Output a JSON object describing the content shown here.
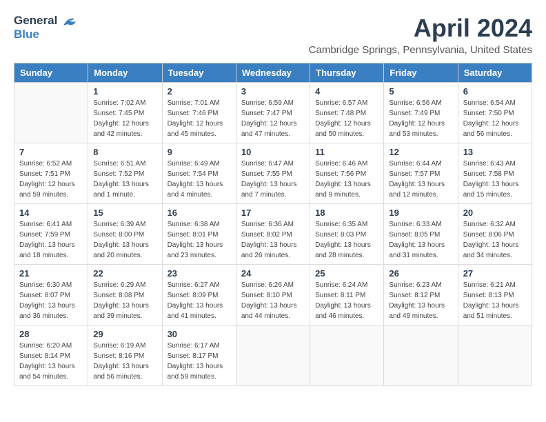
{
  "logo": {
    "general": "General",
    "blue": "Blue"
  },
  "title": "April 2024",
  "subtitle": "Cambridge Springs, Pennsylvania, United States",
  "days_of_week": [
    "Sunday",
    "Monday",
    "Tuesday",
    "Wednesday",
    "Thursday",
    "Friday",
    "Saturday"
  ],
  "weeks": [
    [
      {
        "day": "",
        "info": ""
      },
      {
        "day": "1",
        "info": "Sunrise: 7:02 AM\nSunset: 7:45 PM\nDaylight: 12 hours\nand 42 minutes."
      },
      {
        "day": "2",
        "info": "Sunrise: 7:01 AM\nSunset: 7:46 PM\nDaylight: 12 hours\nand 45 minutes."
      },
      {
        "day": "3",
        "info": "Sunrise: 6:59 AM\nSunset: 7:47 PM\nDaylight: 12 hours\nand 47 minutes."
      },
      {
        "day": "4",
        "info": "Sunrise: 6:57 AM\nSunset: 7:48 PM\nDaylight: 12 hours\nand 50 minutes."
      },
      {
        "day": "5",
        "info": "Sunrise: 6:56 AM\nSunset: 7:49 PM\nDaylight: 12 hours\nand 53 minutes."
      },
      {
        "day": "6",
        "info": "Sunrise: 6:54 AM\nSunset: 7:50 PM\nDaylight: 12 hours\nand 56 minutes."
      }
    ],
    [
      {
        "day": "7",
        "info": "Sunrise: 6:52 AM\nSunset: 7:51 PM\nDaylight: 12 hours\nand 59 minutes."
      },
      {
        "day": "8",
        "info": "Sunrise: 6:51 AM\nSunset: 7:52 PM\nDaylight: 13 hours\nand 1 minute."
      },
      {
        "day": "9",
        "info": "Sunrise: 6:49 AM\nSunset: 7:54 PM\nDaylight: 13 hours\nand 4 minutes."
      },
      {
        "day": "10",
        "info": "Sunrise: 6:47 AM\nSunset: 7:55 PM\nDaylight: 13 hours\nand 7 minutes."
      },
      {
        "day": "11",
        "info": "Sunrise: 6:46 AM\nSunset: 7:56 PM\nDaylight: 13 hours\nand 9 minutes."
      },
      {
        "day": "12",
        "info": "Sunrise: 6:44 AM\nSunset: 7:57 PM\nDaylight: 13 hours\nand 12 minutes."
      },
      {
        "day": "13",
        "info": "Sunrise: 6:43 AM\nSunset: 7:58 PM\nDaylight: 13 hours\nand 15 minutes."
      }
    ],
    [
      {
        "day": "14",
        "info": "Sunrise: 6:41 AM\nSunset: 7:59 PM\nDaylight: 13 hours\nand 18 minutes."
      },
      {
        "day": "15",
        "info": "Sunrise: 6:39 AM\nSunset: 8:00 PM\nDaylight: 13 hours\nand 20 minutes."
      },
      {
        "day": "16",
        "info": "Sunrise: 6:38 AM\nSunset: 8:01 PM\nDaylight: 13 hours\nand 23 minutes."
      },
      {
        "day": "17",
        "info": "Sunrise: 6:36 AM\nSunset: 8:02 PM\nDaylight: 13 hours\nand 26 minutes."
      },
      {
        "day": "18",
        "info": "Sunrise: 6:35 AM\nSunset: 8:03 PM\nDaylight: 13 hours\nand 28 minutes."
      },
      {
        "day": "19",
        "info": "Sunrise: 6:33 AM\nSunset: 8:05 PM\nDaylight: 13 hours\nand 31 minutes."
      },
      {
        "day": "20",
        "info": "Sunrise: 6:32 AM\nSunset: 8:06 PM\nDaylight: 13 hours\nand 34 minutes."
      }
    ],
    [
      {
        "day": "21",
        "info": "Sunrise: 6:30 AM\nSunset: 8:07 PM\nDaylight: 13 hours\nand 36 minutes."
      },
      {
        "day": "22",
        "info": "Sunrise: 6:29 AM\nSunset: 8:08 PM\nDaylight: 13 hours\nand 39 minutes."
      },
      {
        "day": "23",
        "info": "Sunrise: 6:27 AM\nSunset: 8:09 PM\nDaylight: 13 hours\nand 41 minutes."
      },
      {
        "day": "24",
        "info": "Sunrise: 6:26 AM\nSunset: 8:10 PM\nDaylight: 13 hours\nand 44 minutes."
      },
      {
        "day": "25",
        "info": "Sunrise: 6:24 AM\nSunset: 8:11 PM\nDaylight: 13 hours\nand 46 minutes."
      },
      {
        "day": "26",
        "info": "Sunrise: 6:23 AM\nSunset: 8:12 PM\nDaylight: 13 hours\nand 49 minutes."
      },
      {
        "day": "27",
        "info": "Sunrise: 6:21 AM\nSunset: 8:13 PM\nDaylight: 13 hours\nand 51 minutes."
      }
    ],
    [
      {
        "day": "28",
        "info": "Sunrise: 6:20 AM\nSunset: 8:14 PM\nDaylight: 13 hours\nand 54 minutes."
      },
      {
        "day": "29",
        "info": "Sunrise: 6:19 AM\nSunset: 8:16 PM\nDaylight: 13 hours\nand 56 minutes."
      },
      {
        "day": "30",
        "info": "Sunrise: 6:17 AM\nSunset: 8:17 PM\nDaylight: 13 hours\nand 59 minutes."
      },
      {
        "day": "",
        "info": ""
      },
      {
        "day": "",
        "info": ""
      },
      {
        "day": "",
        "info": ""
      },
      {
        "day": "",
        "info": ""
      }
    ]
  ]
}
